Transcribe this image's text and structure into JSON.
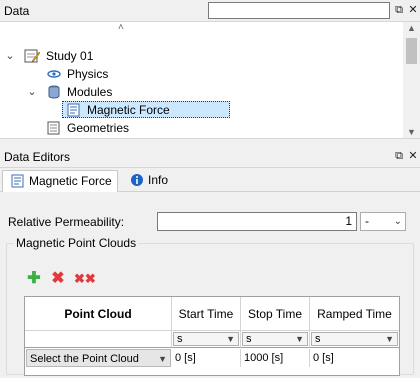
{
  "data_panel": {
    "title": "Data",
    "search_value": "",
    "tree": [
      {
        "label": "Study 01",
        "icon": "study-icon"
      },
      {
        "label": "Physics",
        "icon": "physics-icon"
      },
      {
        "label": "Modules",
        "icon": "database-icon"
      },
      {
        "label": "Magnetic Force",
        "icon": "document-icon",
        "selected": true
      },
      {
        "label": "Geometries",
        "icon": "geometries-icon"
      }
    ]
  },
  "editors_panel": {
    "title": "Data Editors",
    "tabs": [
      {
        "label": "Magnetic Force",
        "active": true
      },
      {
        "label": "Info",
        "active": false
      }
    ]
  },
  "form": {
    "relative_permeability_label": "Relative Permeability:",
    "relative_permeability_value": "1",
    "relative_permeability_unit": "-",
    "group_title": "Magnetic Point Clouds"
  },
  "grid": {
    "columns": [
      "Point Cloud",
      "Start Time",
      "Stop Time",
      "Ramped Time"
    ],
    "units": [
      "s",
      "s",
      "s"
    ],
    "row": {
      "point_cloud": "Select the Point Cloud",
      "start_time": "0 [s]",
      "stop_time": "1000 [s]",
      "ramped_time": "0 [s]"
    }
  },
  "colors": {
    "selection": "#cce8ff",
    "add": "#3cb043",
    "delete": "#e0393e"
  }
}
